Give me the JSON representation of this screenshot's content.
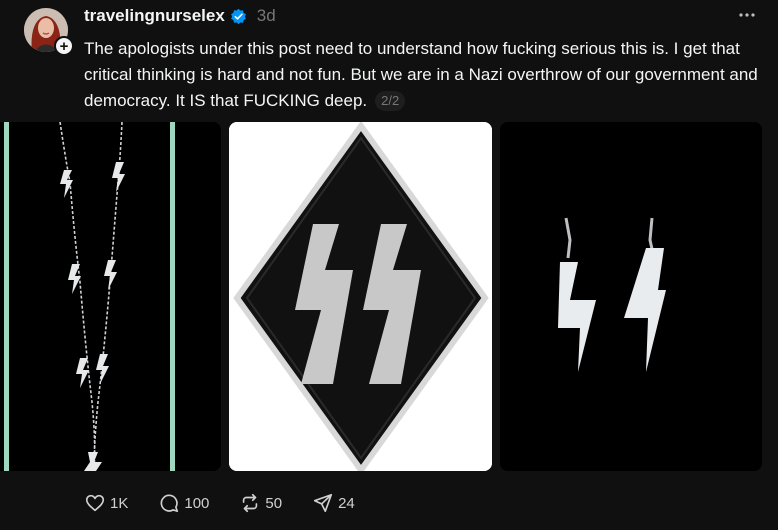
{
  "post": {
    "username": "travelingnurselex",
    "time": "3d",
    "text": "The apologists under this post need to understand how fucking serious this is. I get that critical thinking is hard and not fun. But we are in a Nazi overthrow of our government and democracy. It IS that FUCKING deep.",
    "page_indicator": "2/2",
    "follow_symbol": "+"
  },
  "icons": {
    "verified": "verified-badge-icon",
    "more": "more-options-icon",
    "like": "heart-icon",
    "comment": "comment-icon",
    "repost": "repost-icon",
    "share": "share-icon"
  },
  "actions": {
    "likes": "1K",
    "comments": "100",
    "reposts": "50",
    "shares": "24"
  },
  "colors": {
    "background": "#101010",
    "text": "#f3f5f7",
    "muted": "#777777",
    "verified_blue": "#0095f6"
  }
}
